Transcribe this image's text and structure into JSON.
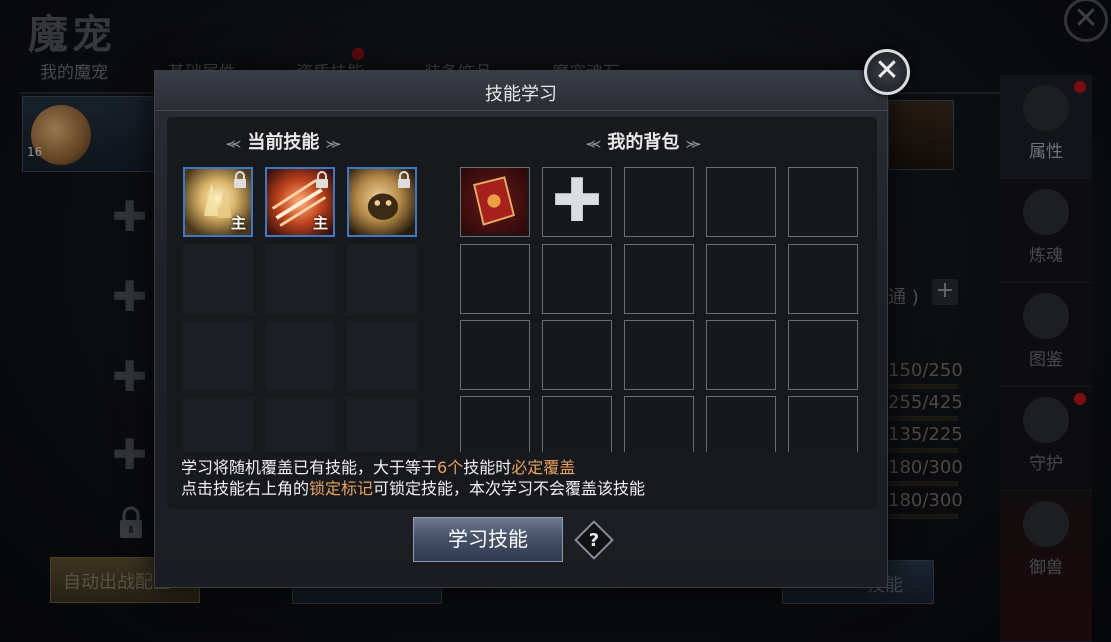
{
  "background": {
    "title": "魔宠",
    "tabs": [
      "我的魔宠",
      "基础属性",
      "资质技能",
      "装备饰品",
      "魔宠魂石"
    ],
    "pet_level": "16",
    "auto_battle_label": "自动出战配置",
    "right_button_label": "技能",
    "tong_label": "通 )",
    "stats": [
      "150/250",
      "255/425",
      "135/225",
      "180/300",
      "180/300"
    ],
    "sidebar": [
      {
        "label": "属性",
        "has_dot": true,
        "active": true
      },
      {
        "label": "炼魂",
        "has_dot": false,
        "active": false
      },
      {
        "label": "图鉴",
        "has_dot": false,
        "active": false
      },
      {
        "label": "守护",
        "has_dot": true,
        "active": false
      },
      {
        "label": "御兽",
        "has_dot": false,
        "active": false
      }
    ]
  },
  "modal": {
    "title": "技能学习",
    "current_skills_title": "当前技能",
    "bag_title": "我的背包",
    "ornament_left": "⪻",
    "ornament_right": "⪼",
    "current_skills": [
      {
        "name": "skill-1",
        "badge": "主",
        "color": "#d9b46a"
      },
      {
        "name": "skill-2",
        "badge": "主",
        "color": "#c0441e"
      },
      {
        "name": "skill-3",
        "badge": "",
        "color": "#b58a48"
      }
    ],
    "notice_line1_parts": [
      "学习将随机覆盖已有技能，大于等于",
      "6个",
      "技能时",
      "必定覆盖"
    ],
    "notice_line2_parts": [
      "点击技能右上角的",
      "锁定标记",
      "可锁定技能，本次学习不会覆盖该技能"
    ],
    "learn_button": "学习技能",
    "help_label": "?",
    "close_label": "✕"
  }
}
